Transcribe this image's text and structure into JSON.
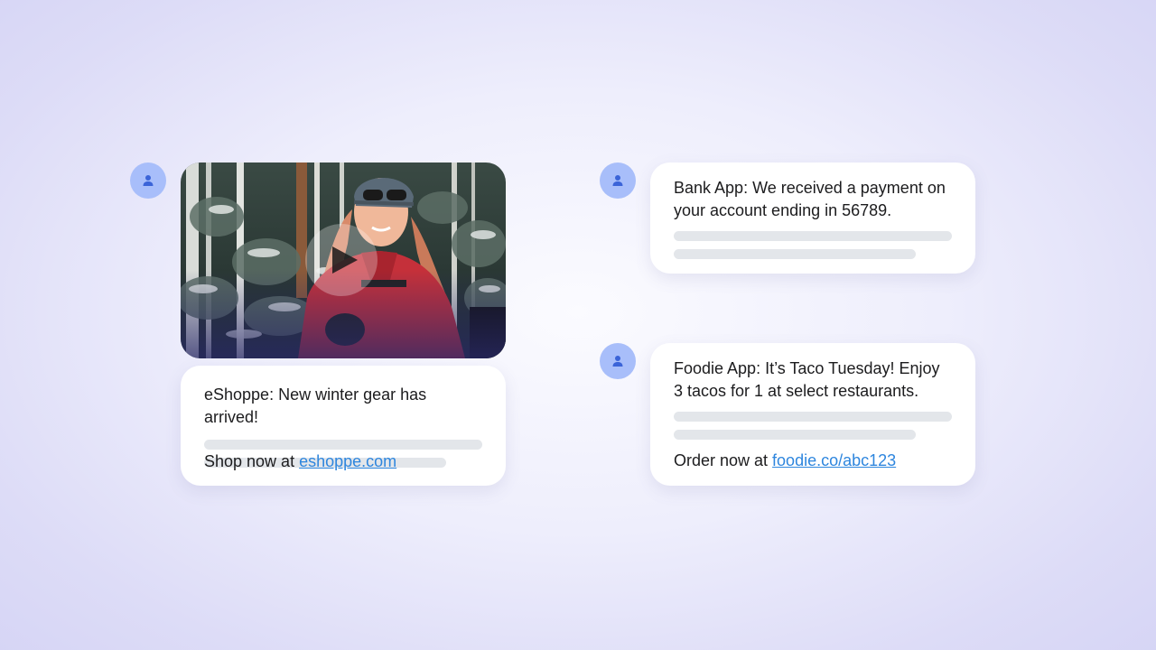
{
  "colors": {
    "avatar_bg": "#a8befa",
    "avatar_icon": "#3b64d8",
    "link": "#2e86de",
    "placeholder_bar": "#e3e6ea"
  },
  "messages": [
    {
      "sender_icon": "user-icon",
      "media": {
        "type": "video",
        "play_icon": "play-icon"
      },
      "text": "eShoppe: New winter gear has arrived!",
      "cta_prefix": "Shop now at ",
      "cta_link": "eshoppe.com"
    },
    {
      "sender_icon": "user-icon",
      "text": "Bank App: We received a payment on your account ending in 56789."
    },
    {
      "sender_icon": "user-icon",
      "text": "Foodie App: It’s Taco Tuesday! Enjoy 3 tacos for 1 at select restaurants.",
      "cta_prefix": "Order now at ",
      "cta_link": "foodie.co/abc123"
    }
  ]
}
